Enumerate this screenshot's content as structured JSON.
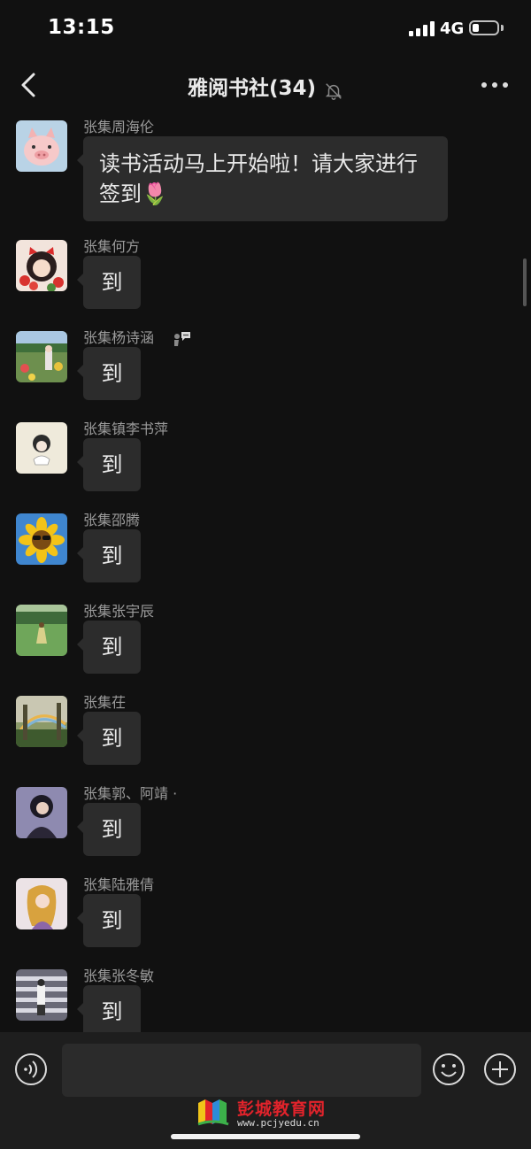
{
  "status_bar": {
    "time": "13:15",
    "network": "4G",
    "battery_level": 0.25
  },
  "nav": {
    "title": "雅阅书社(34)",
    "muted_icon": "bell-off-icon",
    "back_icon": "chevron-left-icon",
    "more_icon": "more-dots-icon"
  },
  "messages": [
    {
      "sender": "张集周海伦",
      "text": "读书活动马上开始啦！请大家进行签到🌷",
      "avatar": "pig-avatar"
    },
    {
      "sender": "张集何方",
      "text": "到",
      "avatar": "girl-with-flowers-avatar"
    },
    {
      "sender": "张集杨诗涵",
      "text": "到",
      "avatar": "garden-photo-avatar"
    },
    {
      "sender": "张集镇李书萍",
      "text": "到",
      "avatar": "sketch-girl-avatar"
    },
    {
      "sender": "张集邵腾",
      "text": "到",
      "avatar": "sunflower-avatar"
    },
    {
      "sender": "张集张宇辰",
      "text": "到",
      "avatar": "meadow-photo-avatar"
    },
    {
      "sender": "张集茌",
      "text": "到",
      "avatar": "rainbow-forest-avatar"
    },
    {
      "sender": "张集郭、阿靖 ·",
      "text": "到",
      "avatar": "portrait-photo-avatar"
    },
    {
      "sender": "张集陆雅倩",
      "text": "到",
      "avatar": "painted-lady-avatar"
    },
    {
      "sender": "张集张冬敏",
      "text": "到",
      "avatar": "crosswalk-photo-avatar"
    }
  ],
  "input_bar": {
    "voice_icon": "voice-icon",
    "input_placeholder": "",
    "emoji_icon": "emoji-icon",
    "plus_icon": "plus-icon"
  },
  "watermark": {
    "title": "彭城教育网",
    "url": "www.pcjyedu.cn"
  }
}
